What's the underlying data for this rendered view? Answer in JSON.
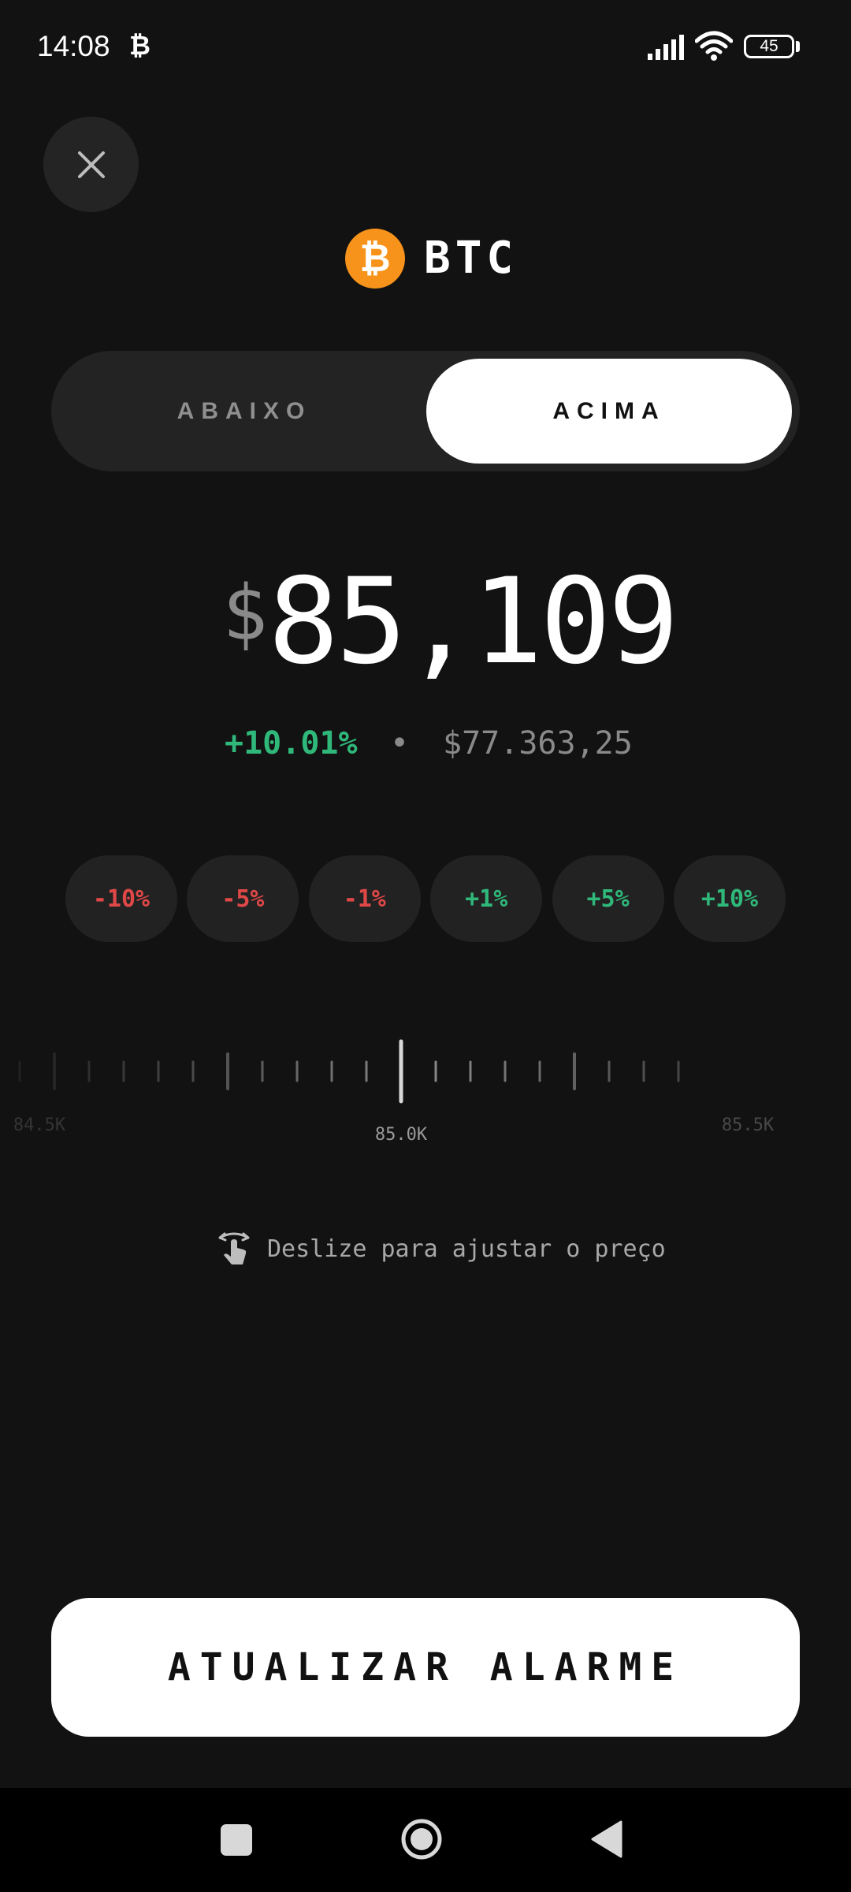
{
  "status_bar": {
    "time": "14:08",
    "notification_icon": "₿",
    "battery": "45"
  },
  "asset": {
    "icon_glyph": "₿",
    "symbol": "BTC",
    "brand_color": "#f7931a"
  },
  "direction_toggle": {
    "below_label": "ABAIXO",
    "above_label": "ACIMA",
    "selected": "above"
  },
  "price": {
    "currency": "$",
    "value": "85,109"
  },
  "change": {
    "percent": "+10.01%",
    "separator": "•",
    "reference_price": "$77.363,25"
  },
  "quick_adjust": [
    {
      "label": "-10%",
      "tone": "negative"
    },
    {
      "label": "-5%",
      "tone": "negative"
    },
    {
      "label": "-1%",
      "tone": "negative"
    },
    {
      "label": "+1%",
      "tone": "positive"
    },
    {
      "label": "+5%",
      "tone": "positive"
    },
    {
      "label": "+10%",
      "tone": "positive"
    }
  ],
  "price_slider": {
    "labels": [
      "84.5K",
      "85.0K",
      "85.5K"
    ],
    "current_value": 85109
  },
  "hint": {
    "icon": "swipe-gesture-icon",
    "text": "Deslize para ajustar o preço"
  },
  "primary_action": {
    "label": "ATUALIZAR ALARME"
  },
  "colors": {
    "background": "#121212",
    "positive": "#2fb87a",
    "negative": "#e04848"
  }
}
